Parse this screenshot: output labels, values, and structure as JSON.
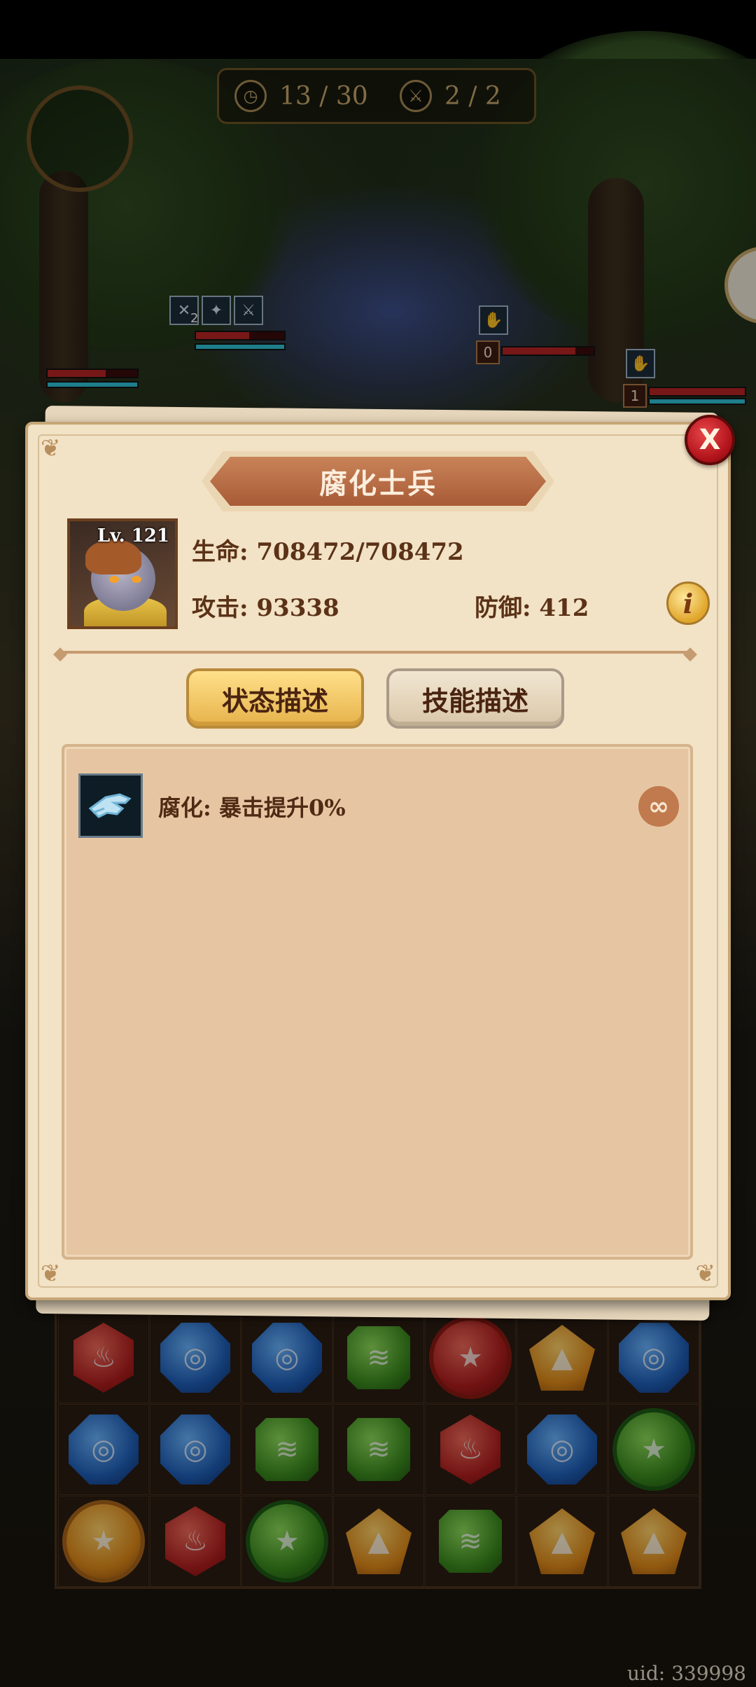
{
  "hud": {
    "turns": "13 / 30",
    "waves": "2 / 2",
    "turns_icon": "clock-icon",
    "waves_icon": "sword-icon"
  },
  "field": {
    "enemy_stack_counts": [
      "0",
      "1"
    ],
    "buff_stack": "2"
  },
  "dialog": {
    "title": "腐化士兵",
    "level": "Lv. 121",
    "hp": "生命: 708472/708472",
    "attack": "攻击: 93338",
    "defense": "防御: 412",
    "close_label": "X",
    "info_label": "i",
    "tabs": {
      "status": "状态描述",
      "skills": "技能描述"
    },
    "status_effects": [
      {
        "text": "腐化: 暴击提升0%",
        "icon": "corruption-hand-icon",
        "duration_symbol": "∞"
      }
    ]
  },
  "board": {
    "rows": [
      [
        "red",
        "blue",
        "blue",
        "green",
        "red-star",
        "yellow",
        "blue"
      ],
      [
        "blue",
        "blue",
        "green",
        "green",
        "red",
        "blue",
        "green-star"
      ],
      [
        "yellow-star",
        "red",
        "green-star",
        "yellow",
        "green",
        "yellow",
        "yellow"
      ]
    ]
  },
  "footer": {
    "uid": "uid: 339998"
  },
  "colors": {
    "panel_bg": "#f2e2c6",
    "title_ribbon": "#b8683e",
    "text_brown": "#5b3217",
    "active_tab": "#f2c45e",
    "close_red": "#c41a20"
  }
}
